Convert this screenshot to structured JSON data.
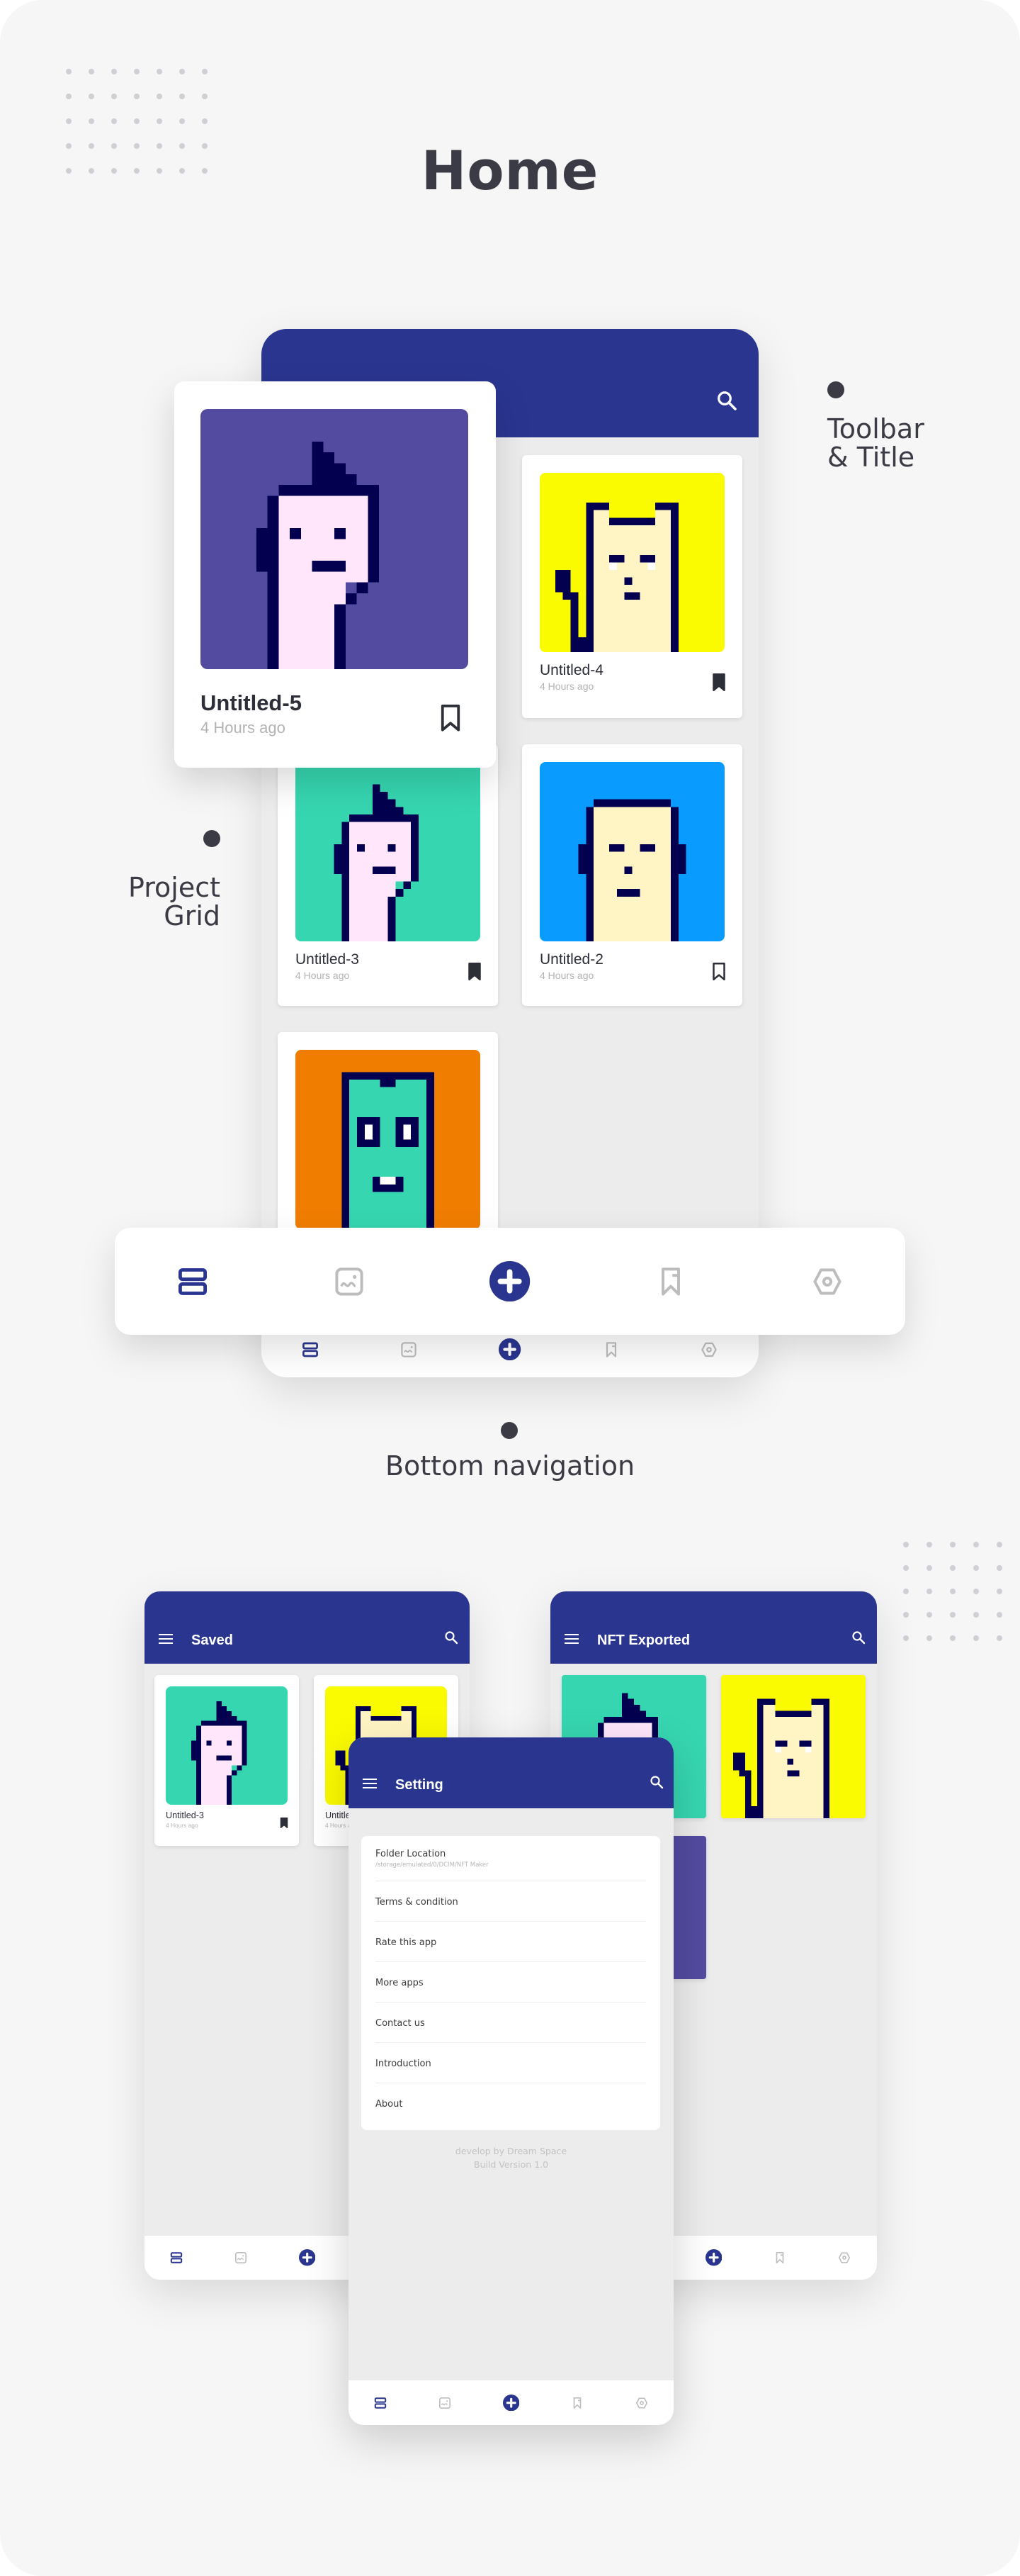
{
  "page_title": "Home",
  "annotations": {
    "toolbar": [
      "Toolbar",
      "& Title"
    ],
    "grid": [
      "Project",
      "Grid"
    ],
    "bottom_nav": "Bottom navigation"
  },
  "colors": {
    "primary": "#2a3590",
    "background": "#ececec",
    "inactive_icon": "#bdbdbd"
  },
  "home": {
    "search_icon": "search-icon",
    "featured": {
      "title": "Untitled-5",
      "subtitle": "4 Hours ago",
      "bookmarked": false,
      "avatar": "punk",
      "bg": "#524ba0"
    },
    "cards": [
      {
        "title": "Untitled-4",
        "subtitle": "4 Hours ago",
        "bookmarked": true,
        "avatar": "cat",
        "bg": "#fafa00"
      },
      {
        "title": "Untitled-3",
        "subtitle": "4 Hours ago",
        "bookmarked": true,
        "avatar": "punk",
        "bg": "#36d6b0"
      },
      {
        "title": "Untitled-2",
        "subtitle": "4 Hours ago",
        "bookmarked": false,
        "avatar": "bald",
        "bg": "#0a9bff"
      },
      {
        "title": "",
        "subtitle": "",
        "avatar": "alien",
        "bg": "#f07d00"
      }
    ]
  },
  "nav": {
    "items": [
      {
        "icon": "projects-icon",
        "active": true
      },
      {
        "icon": "gallery-icon",
        "active": false
      },
      {
        "icon": "add-icon",
        "active": false
      },
      {
        "icon": "bookmark-icon",
        "active": false
      },
      {
        "icon": "settings-icon",
        "active": false
      }
    ]
  },
  "saved": {
    "title": "Saved",
    "cards": [
      {
        "title": "Untitled-3",
        "subtitle": "4 Hours ago",
        "avatar": "punk",
        "bg": "#36d6b0"
      },
      {
        "title": "Untitled-4",
        "subtitle": "4 Hours ago",
        "avatar": "cat",
        "bg": "#fafa00"
      }
    ]
  },
  "exported": {
    "title": "NFT Exported",
    "images": [
      {
        "avatar": "punk",
        "bg": "#36d6b0"
      },
      {
        "avatar": "cat",
        "bg": "#fafa00"
      },
      {
        "avatar": "none",
        "bg": "#524ba0"
      }
    ]
  },
  "setting": {
    "title": "Setting",
    "folder_label": "Folder Location",
    "folder_path": "/storage/emulated/0/DCIM/NFT Maker",
    "items": [
      "Terms & condition",
      "Rate this app",
      "More apps",
      "Contact us",
      "Introduction",
      "About"
    ],
    "footer_line1": "develop by Dream Space",
    "footer_line2": "Build Version 1.0"
  }
}
